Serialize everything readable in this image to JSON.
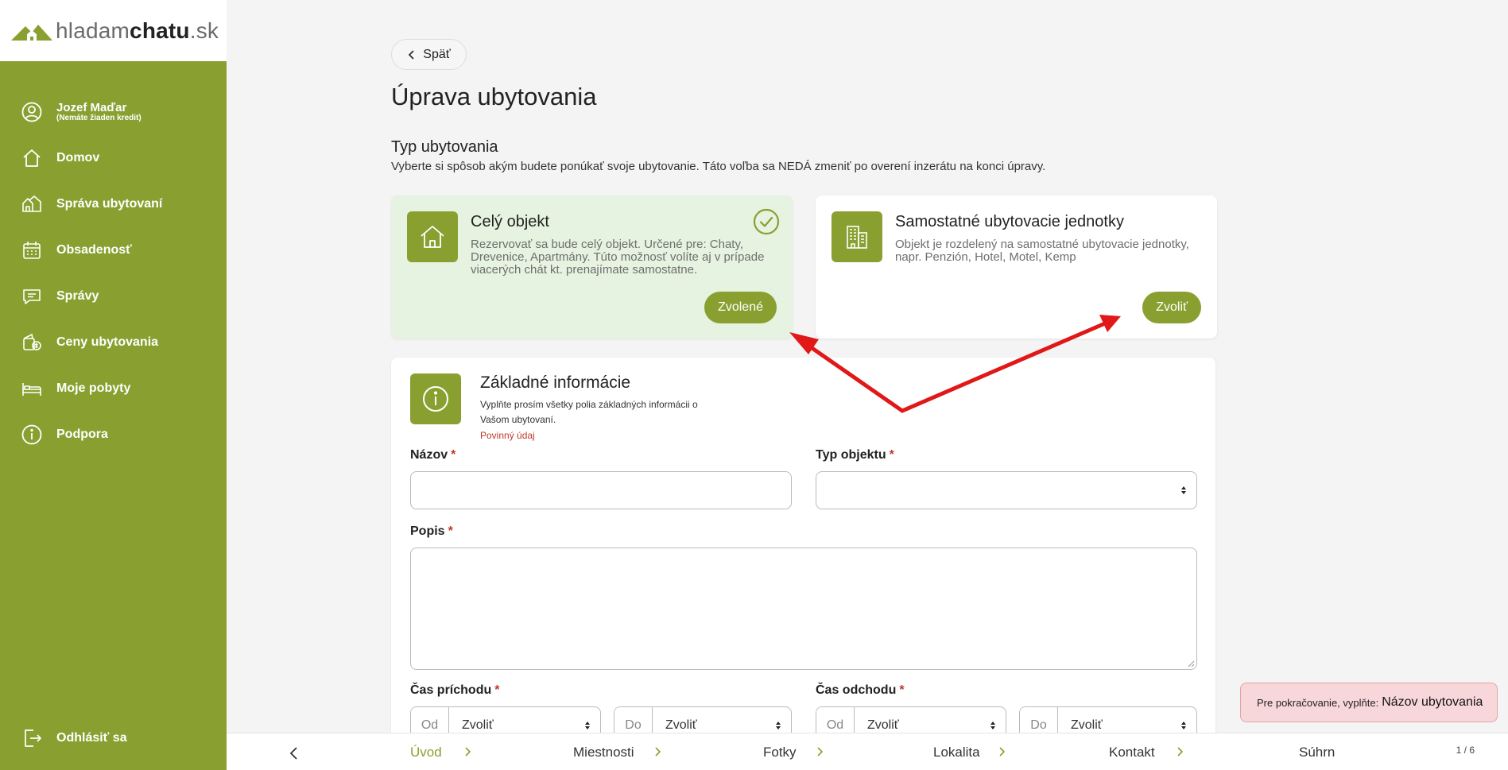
{
  "brand": {
    "logo_light": "hladam",
    "logo_bold": "chatu",
    "logo_tld": ".sk",
    "accent": "#89a030"
  },
  "sidebar": {
    "user": {
      "name": "Jozef Maďar",
      "subtitle": "(Nemáte žiaden kredit)",
      "icon": "user-icon"
    },
    "items": [
      {
        "label": "Domov",
        "icon": "home-icon"
      },
      {
        "label": "Správa ubytovaní",
        "icon": "houses-icon"
      },
      {
        "label": "Obsadenosť",
        "icon": "calendar-icon"
      },
      {
        "label": "Správy",
        "icon": "message-icon"
      },
      {
        "label": "Ceny ubytovania",
        "icon": "money-icon"
      },
      {
        "label": "Moje pobyty",
        "icon": "bed-icon"
      },
      {
        "label": "Podpora",
        "icon": "info-icon"
      }
    ],
    "logout": {
      "label": "Odhlásiť sa",
      "icon": "logout-icon"
    }
  },
  "main": {
    "back_label": "Späť",
    "page_title": "Úprava ubytovania",
    "type_section": {
      "title": "Typ ubytovania",
      "description": "Vyberte si spôsob akým budete ponúkať svoje ubytovanie. Táto voľba sa NEDÁ zmeniť po overení inzerátu na konci úpravy.",
      "options": [
        {
          "title": "Celý objekt",
          "description": "Rezervovať sa bude celý objekt. Určené pre: Chaty, Drevenice, Apartmány. Túto možnosť volíte aj v prípade viacerých chát kt. prenajímate samostatne.",
          "button": "Zvolené",
          "selected": true
        },
        {
          "title": "Samostatné ubytovacie jednotky",
          "description": "Objekt je rozdelený na samostatné ubytovacie jednotky, napr. Penzión, Hotel, Motel, Kemp",
          "button": "Zvoliť",
          "selected": false
        }
      ]
    },
    "basic_info": {
      "title": "Základné informácie",
      "description": "Vyplňte prosím všetky polia základných informácii o Vašom ubytovaní.",
      "required_note": "Povinný údaj",
      "fields": {
        "name_label": "Názov",
        "name_value": "",
        "type_label": "Typ objektu",
        "type_value": "",
        "description_label": "Popis",
        "description_value": "",
        "arrival_label": "Čas príchodu",
        "departure_label": "Čas odchodu",
        "from_prefix": "Od",
        "to_prefix": "Do",
        "select_placeholder": "Zvoliť"
      },
      "required_marker": "*"
    }
  },
  "stepper": {
    "steps": [
      "Úvod",
      "Miestnosti",
      "Fotky",
      "Lokalita",
      "Kontakt",
      "Súhrn"
    ],
    "active_index": 0,
    "counter": "1 / 6"
  },
  "toast": {
    "prefix": "Pre pokračovanie, vyplňte:",
    "field": "Názov ubytovania"
  }
}
